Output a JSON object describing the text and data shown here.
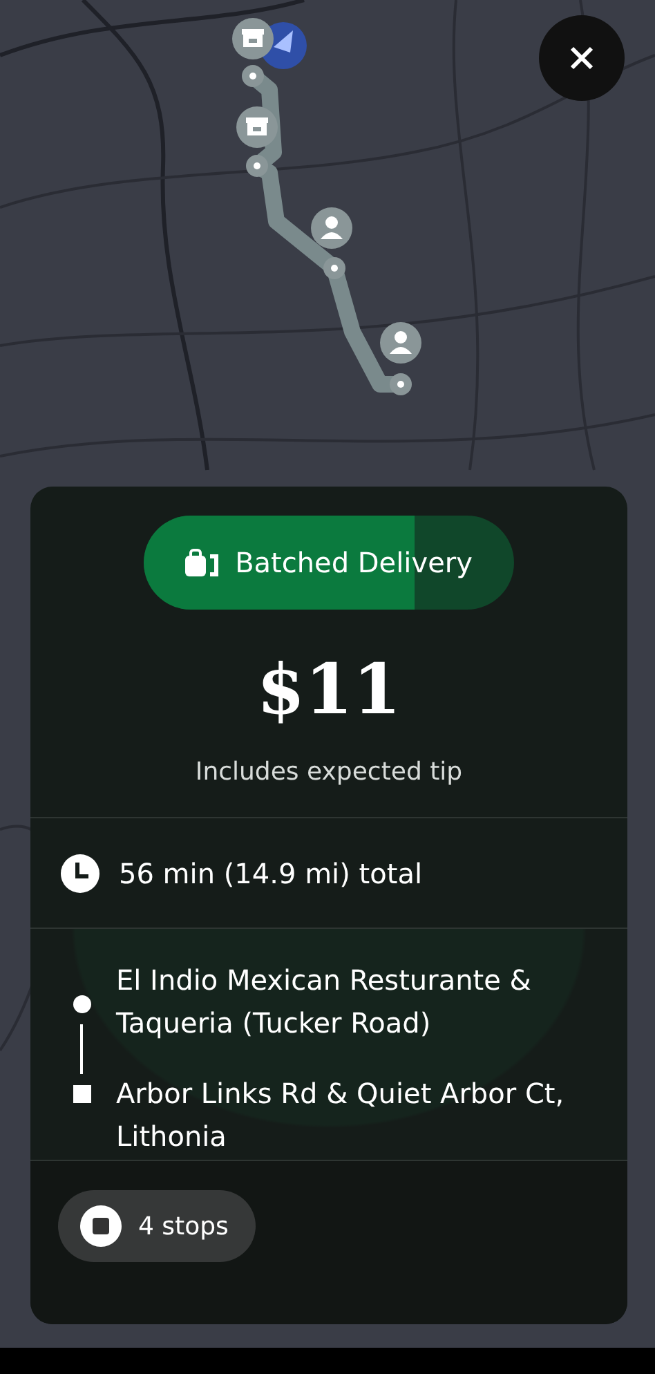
{
  "map": {
    "kind": "picture",
    "markers": [
      {
        "kind": "store"
      },
      {
        "kind": "store"
      },
      {
        "kind": "customer"
      },
      {
        "kind": "customer"
      }
    ]
  },
  "badge": {
    "label": "Batched Delivery",
    "level": 0.73
  },
  "price": "$11",
  "price_note": "Includes expected tip",
  "duration": "56 min (14.9 mi) total",
  "route": [
    {
      "kind": "pickup",
      "name": "El Indio Mexican Resturante & Taqueria (Tucker Road)"
    },
    {
      "kind": "dropoff",
      "name": "Arbor Links Rd & Quiet Arbor Ct, Lithonia"
    }
  ],
  "stops": "4 stops"
}
